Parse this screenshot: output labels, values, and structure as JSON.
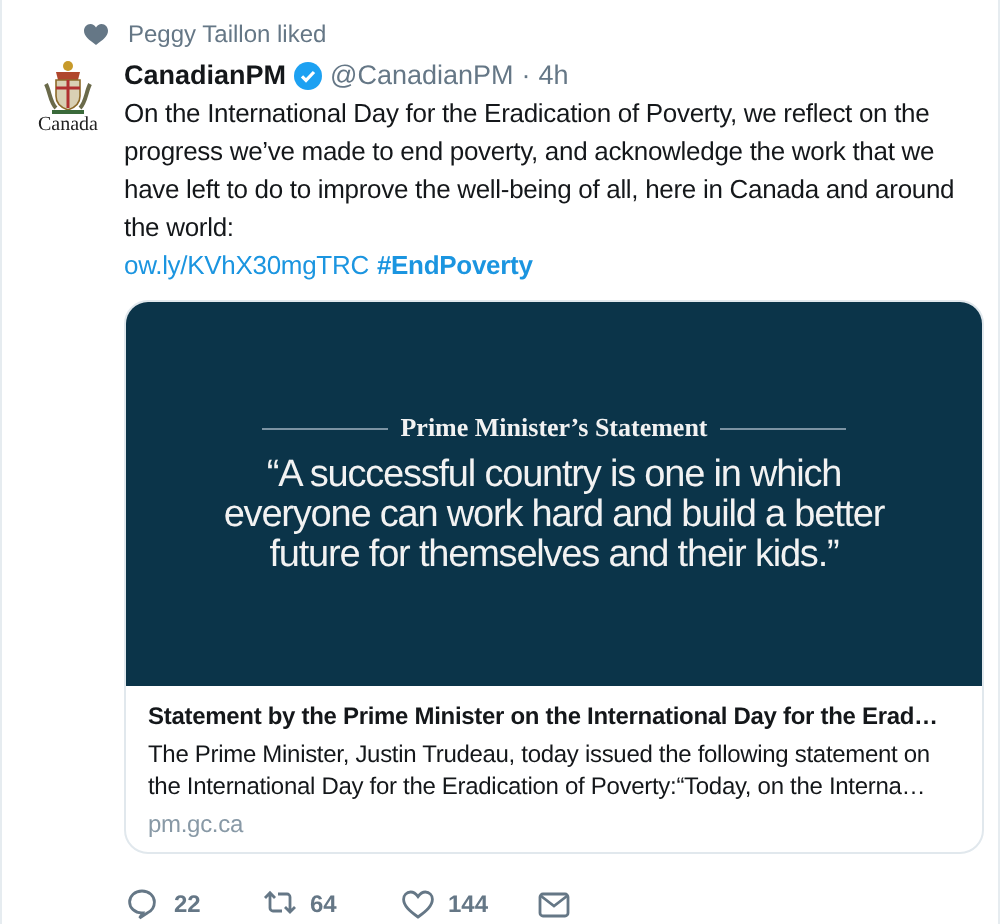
{
  "social_context": {
    "text": "Peggy Taillon liked"
  },
  "tweet": {
    "avatar": {
      "wordmark": "Canada"
    },
    "name": "CanadianPM",
    "verified": true,
    "handle": "@CanadianPM",
    "separator": "·",
    "time": "4h",
    "text": "On the International Day for the Eradication of Poverty, we reflect on the progress we’ve made to end poverty, and acknowledge the work that we have left to do to improve the well-being of all, here in Canada and around the world:",
    "link": "ow.ly/KVhX30mgTRC",
    "hashtag": "#EndPoverty"
  },
  "card": {
    "image": {
      "heading": "Prime Minister’s Statement",
      "quote": "“A successful country is one in which everyone can work hard and build a better future for themselves and their kids.”"
    },
    "title": "Statement by the Prime Minister on the International Day for the Erad…",
    "description": "The Prime Minister, Justin Trudeau, today issued the following statement on the International Day for the Eradication of Poverty:“Today, on the Interna…",
    "domain": "pm.gc.ca"
  },
  "actions": [
    {
      "kind": "reply",
      "count": "22"
    },
    {
      "kind": "retweet",
      "count": "64"
    },
    {
      "kind": "like",
      "count": "144"
    },
    {
      "kind": "message"
    }
  ]
}
